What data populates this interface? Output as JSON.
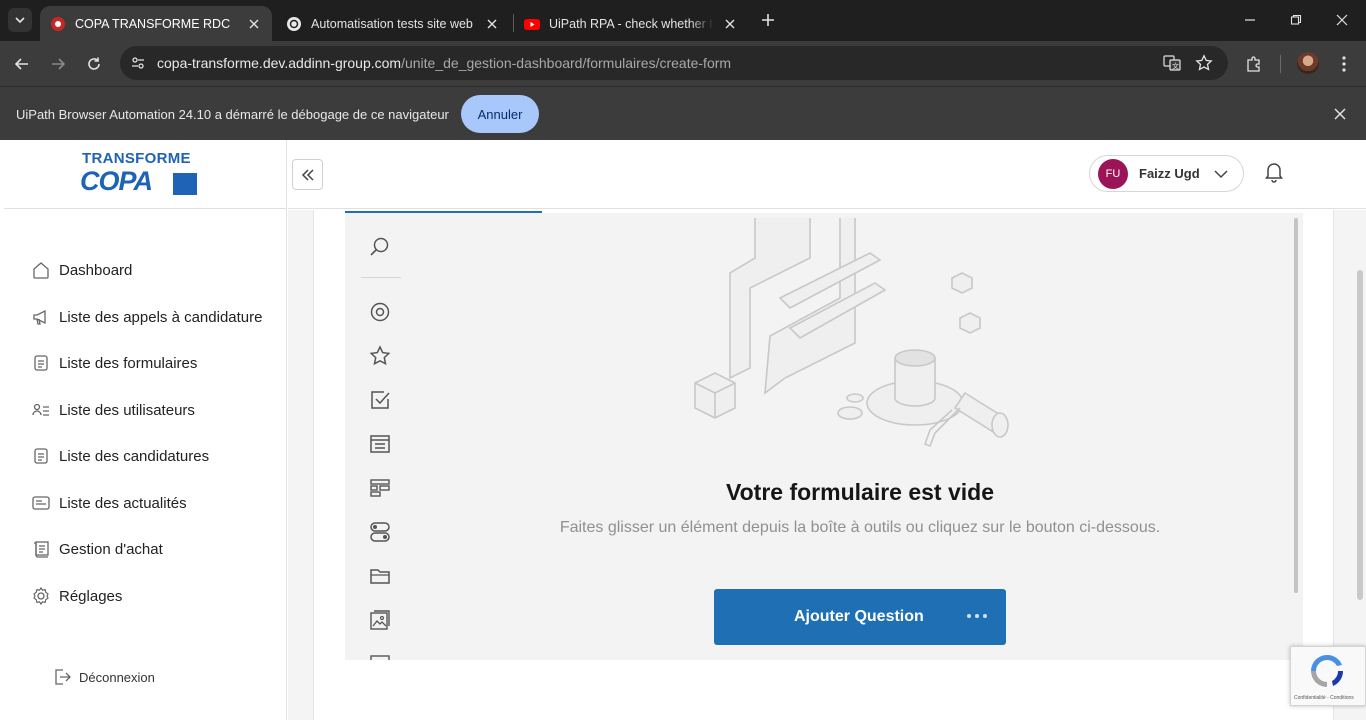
{
  "browser": {
    "tabs": [
      {
        "title": "COPA TRANSFORME RDC",
        "active": true
      },
      {
        "title": "Automatisation tests site web",
        "active": false
      },
      {
        "title": "UiPath RPA - check whether the",
        "active": false
      }
    ],
    "url_host": "copa-transforme.dev.addinn-group.com",
    "url_path": "/unite_de_gestion-dashboard/formulaires/create-form"
  },
  "infobar": {
    "message": "UiPath Browser Automation 24.10 a démarré le débogage de ce navigateur",
    "cancel_label": "Annuler"
  },
  "logo": {
    "line1": "TRANSFORME",
    "line2": "COPA"
  },
  "sidebar": {
    "items": [
      {
        "label": "Dashboard",
        "icon": "home-icon"
      },
      {
        "label": "Liste des appels à candidature",
        "icon": "megaphone-icon"
      },
      {
        "label": "Liste des formulaires",
        "icon": "document-icon"
      },
      {
        "label": "Liste des utilisateurs",
        "icon": "users-list-icon"
      },
      {
        "label": "Liste des candidatures",
        "icon": "document-icon"
      },
      {
        "label": "Liste des actualités",
        "icon": "news-icon"
      },
      {
        "label": "Gestion d'achat",
        "icon": "receipt-icon"
      },
      {
        "label": "Réglages",
        "icon": "gear-icon"
      }
    ],
    "logout_label": "Déconnexion"
  },
  "header": {
    "user_initials": "FU",
    "user_name": "Faizz Ugd"
  },
  "creator": {
    "empty_title": "Votre formulaire est vide",
    "empty_subtitle": "Faites glisser un élément depuis la boîte à outils ou cliquez sur le bouton ci-dessous.",
    "add_question_label": "Ajouter Question",
    "toolbox_icons": [
      "search-icon",
      "radio-icon",
      "rating-star-icon",
      "checkbox-icon",
      "dropdown-icon",
      "ranking-icon",
      "boolean-toggle-icon",
      "file-folder-icon",
      "image-picker-icon"
    ]
  },
  "recaptcha": {
    "label": "Confidentialité - Conditions"
  },
  "colors": {
    "accent": "#1f6fb5",
    "avatar": "#9c1458",
    "infobar_button": "#a8c7fa"
  }
}
